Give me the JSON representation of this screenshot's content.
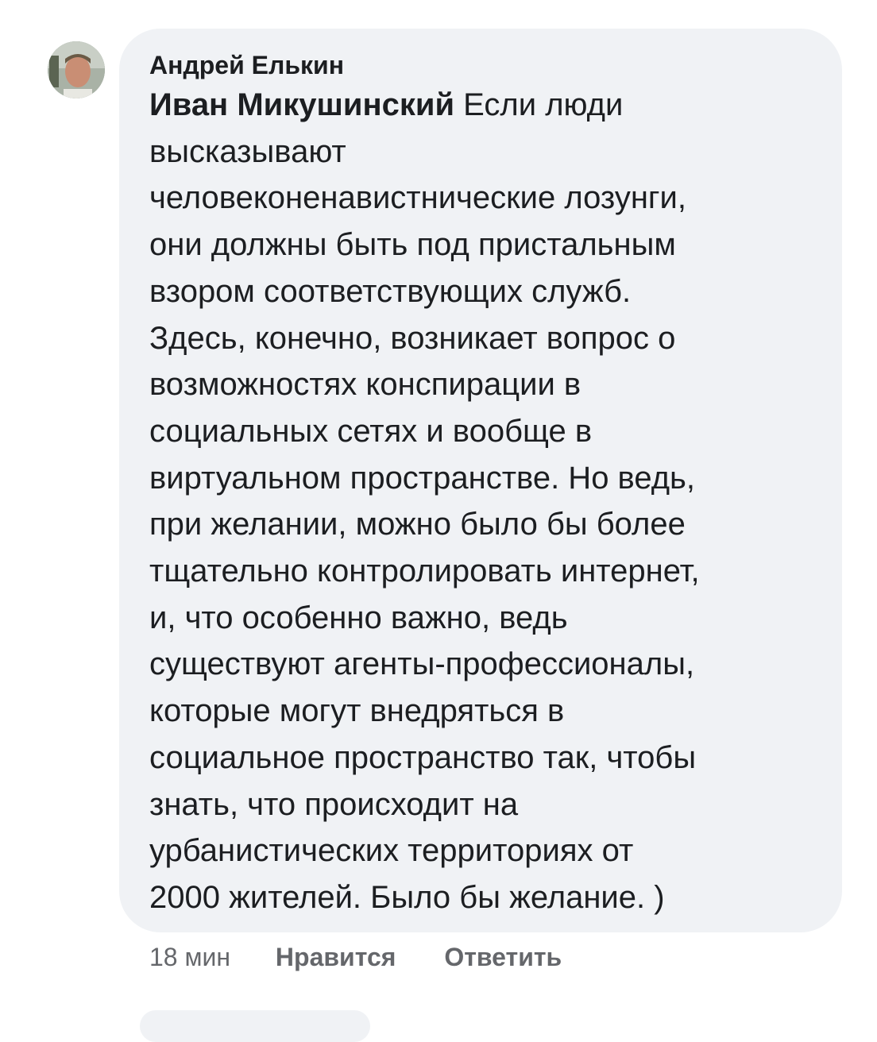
{
  "comment": {
    "author": "Андрей Елькин",
    "mention": "Иван Микушинский",
    "first_line_rest": " Если люди",
    "lines": [
      "высказывают",
      "человеконенавистнические лозунги,",
      "они должны быть под пристальным",
      "взором соответствующих служб.",
      "Здесь, конечно, возникает вопрос о",
      "возможностях конспирации в",
      "социальных сетях и вообще в",
      "виртуальном пространстве. Но ведь,",
      "при желании, можно было бы более",
      "тщательно контролировать интернет,",
      "и, что особенно важно, ведь",
      "существуют агенты-профессионалы,",
      "которые могут внедряться в",
      "социальное пространство так, чтобы",
      "знать, что происходит на",
      "урбанистических территориях от",
      "2000 жителей. Было бы желание. )"
    ],
    "time": "18 мин",
    "like_label": "Нравится",
    "reply_label": "Ответить"
  },
  "colors": {
    "bubble_background": "#f0f2f5",
    "text": "#1c1e21",
    "secondary_text": "#65676b"
  }
}
